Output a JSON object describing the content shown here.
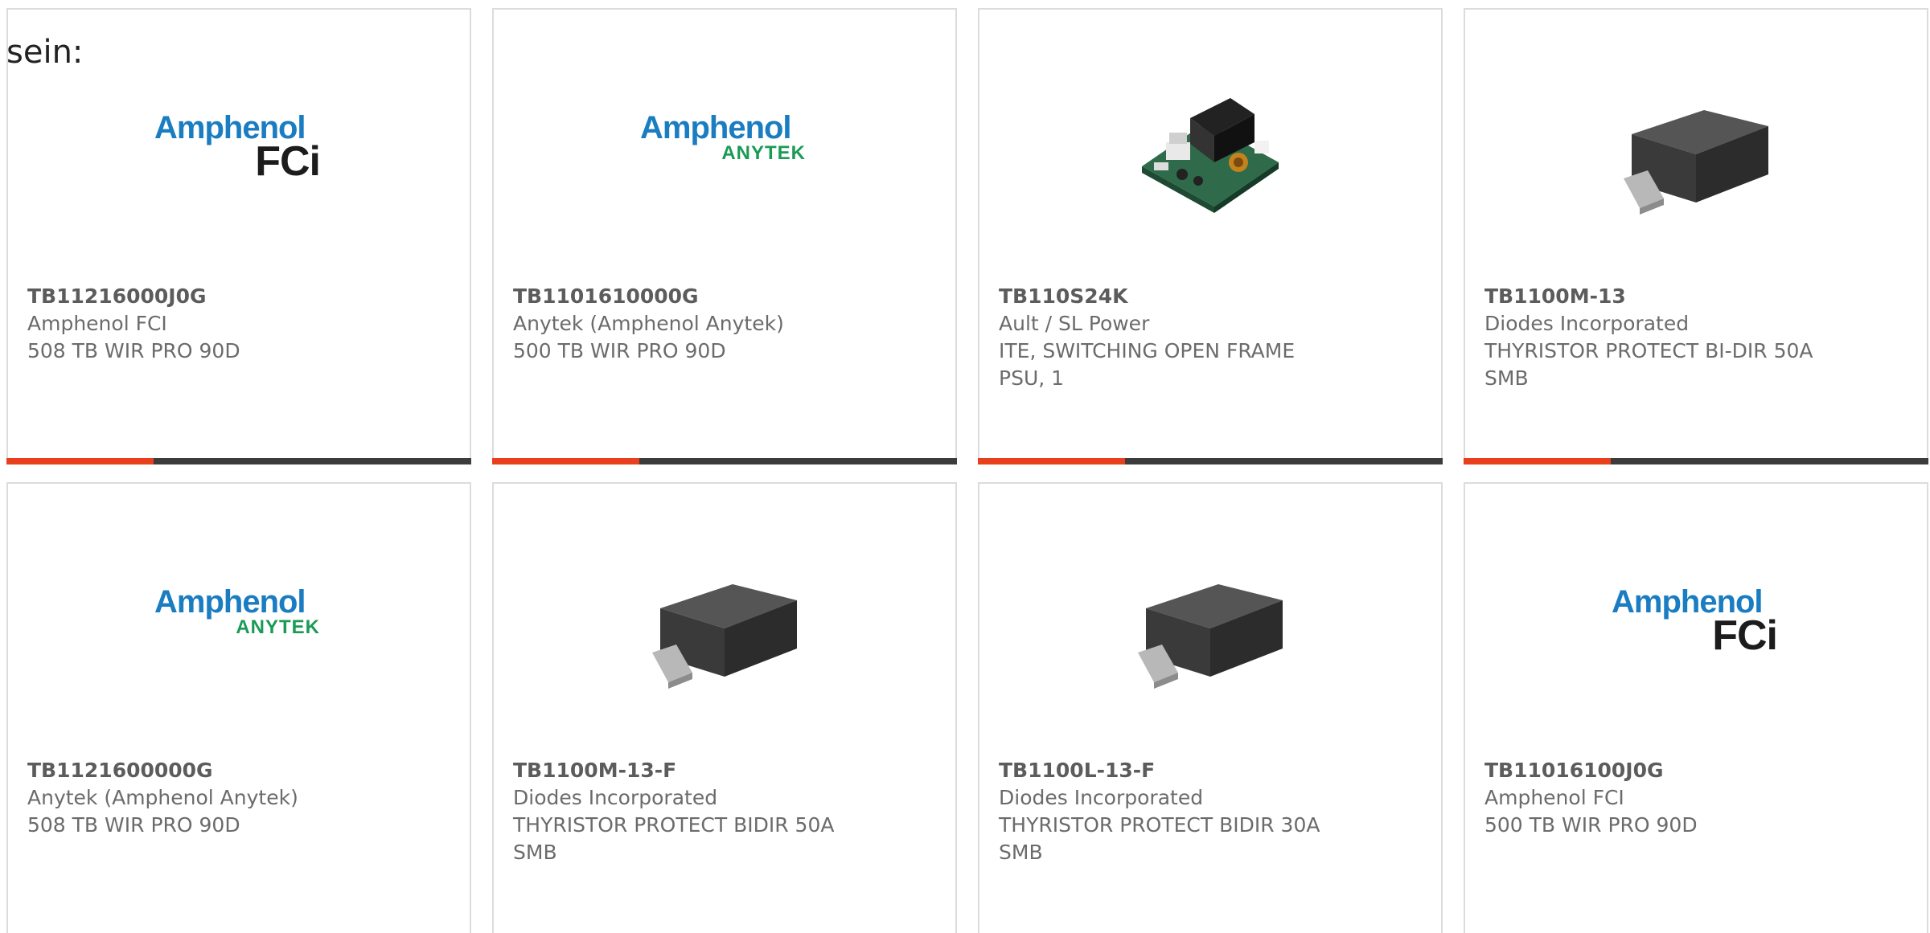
{
  "intro": {
    "text": "sein:"
  },
  "colors": {
    "accent": "#e8401c",
    "bar": "#3c3c3c",
    "amphenol_blue": "#1a7cc1",
    "anytek_green": "#1a9a55"
  },
  "products": [
    {
      "part_number": "TB11216000J0G",
      "manufacturer": "Amphenol FCI",
      "description_1": "508 TB WIR PRO 90D",
      "description_2": "",
      "image": "amphenol-fci-logo",
      "logo": {
        "brand": "Amphenol",
        "sub": "FCi"
      }
    },
    {
      "part_number": "TB1101610000G",
      "manufacturer": "Anytek (Amphenol Anytek)",
      "description_1": "500 TB WIR PRO 90D",
      "description_2": "",
      "image": "amphenol-anytek-logo",
      "logo": {
        "brand": "Amphenol",
        "sub": "ANYTEK"
      }
    },
    {
      "part_number": "TB110S24K",
      "manufacturer": "Ault / SL Power",
      "description_1": "ITE, SWITCHING OPEN FRAME",
      "description_2": "PSU, 1",
      "image": "power-supply-board-image"
    },
    {
      "part_number": "TB1100M-13",
      "manufacturer": "Diodes Incorporated",
      "description_1": "THYRISTOR PROTECT BI-DIR 50A",
      "description_2": "SMB",
      "image": "smb-package-image"
    },
    {
      "part_number": "TB1121600000G",
      "manufacturer": "Anytek (Amphenol Anytek)",
      "description_1": "508 TB WIR PRO 90D",
      "description_2": "",
      "image": "amphenol-anytek-logo",
      "logo": {
        "brand": "Amphenol",
        "sub": "ANYTEK"
      }
    },
    {
      "part_number": "TB1100M-13-F",
      "manufacturer": "Diodes Incorporated",
      "description_1": "THYRISTOR PROTECT BIDIR 50A",
      "description_2": "SMB",
      "image": "smb-package-image"
    },
    {
      "part_number": "TB1100L-13-F",
      "manufacturer": "Diodes Incorporated",
      "description_1": "THYRISTOR PROTECT BIDIR 30A",
      "description_2": "SMB",
      "image": "smb-package-image"
    },
    {
      "part_number": "TB11016100J0G",
      "manufacturer": "Amphenol FCI",
      "description_1": "500 TB WIR PRO 90D",
      "description_2": "",
      "image": "amphenol-fci-logo",
      "logo": {
        "brand": "Amphenol",
        "sub": "FCi"
      }
    }
  ]
}
